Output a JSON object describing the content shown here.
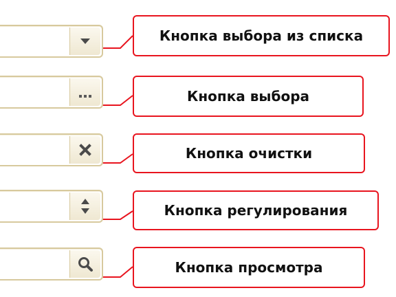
{
  "accent_color": "#e8141e",
  "field_border_color": "#d7c99d",
  "controls": [
    {
      "icon": "dropdown-arrow-icon",
      "label": "Кнопка выбора из списка"
    },
    {
      "icon": "ellipsis-icon",
      "label": "Кнопка выбора"
    },
    {
      "icon": "clear-x-icon",
      "label": "Кнопка очистки"
    },
    {
      "icon": "spinner-arrows-icon",
      "label": "Кнопка регулирования"
    },
    {
      "icon": "magnifier-icon",
      "label": "Кнопка просмотра"
    }
  ]
}
